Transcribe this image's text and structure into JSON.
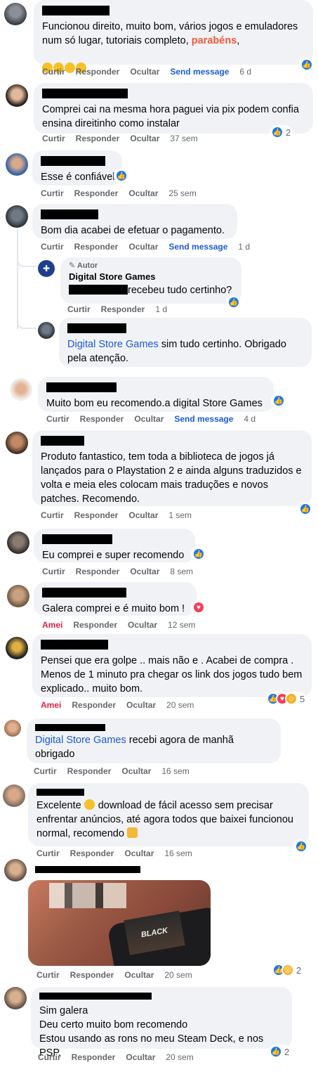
{
  "labels": {
    "like": "Curtir",
    "reply": "Responder",
    "hide": "Ocultar",
    "send": "Send message",
    "loved": "Amei",
    "author": "Autor"
  },
  "comments": [
    {
      "text": "Funcionou direito, muito bom, vários jogos e emuladores num só lugar, tutoriais completo, ",
      "highlight": "parabéns",
      "time": "6 d"
    },
    {
      "text": "Comprei cai na mesma hora paguei via pix podem confia ensina direitinho como instalar",
      "time": "37 sem",
      "reactions": "2"
    },
    {
      "text": "Esse é confiável",
      "time": "25 sem"
    },
    {
      "text": "Bom dia acabei de efetuar o pagamento.",
      "time": "1 d"
    },
    {
      "page_name": "Digital Store Games",
      "text": "recebeu tudo certinho?",
      "time": "1 d"
    },
    {
      "mention": "Digital Store Games",
      "text": " sim tudo certinho. Obrigado pela atenção."
    },
    {
      "text": "Muito bom eu recomendo.a digital Store Games",
      "time": "4 d"
    },
    {
      "text": "Produto fantastico, tem toda a biblioteca de jogos já lançados para o Playstation 2 e ainda alguns traduzidos e volta e meia eles colocam mais traduções e novos patches. Recomendo.",
      "time": "1 sem"
    },
    {
      "text": "Eu comprei e super recomendo",
      "time": "8 sem"
    },
    {
      "text": "Galera comprei e é muito bom !",
      "time": "12 sem"
    },
    {
      "text": "Pensei que era golpe .. mais não e . Acabei de compra . Menos de 1 minuto pra chegar os link dos jogos tudo bem explicado.. muito bom.",
      "time": "20 sem",
      "reactions": "5"
    },
    {
      "mention": "Digital Store Games",
      "text": " recebi agora de manhã obrigado",
      "time": "16 sem"
    },
    {
      "text_a": "Excelente ",
      "text_b": " download de fácil acesso sem precisar enfrentar anúncios, até agora todos que baixei funcionou normal, recomendo ",
      "time": "16 sem"
    },
    {
      "photo_caption": "BLACK",
      "time": "20 sem",
      "reactions": "2"
    },
    {
      "text": "Sim galera\nDeu certo muito bom recomendo\nEstou usando as rons no meu Steam Deck, e nos PSP.",
      "time": "20 sem",
      "reactions": "2"
    }
  ]
}
